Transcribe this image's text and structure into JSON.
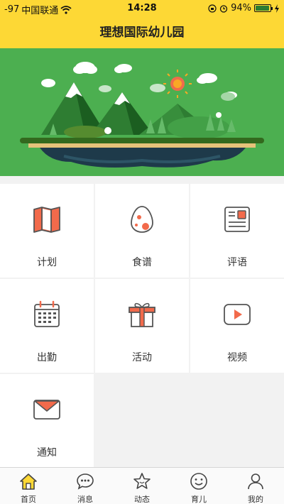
{
  "status": {
    "signal": "-97",
    "carrier": "中国联通",
    "time": "14:28",
    "battery_pct": "94%",
    "battery_level": 0.94
  },
  "header": {
    "title": "理想国际幼儿园"
  },
  "features": [
    {
      "label": "计划",
      "icon": "plan-map-icon"
    },
    {
      "label": "食谱",
      "icon": "recipe-egg-icon"
    },
    {
      "label": "评语",
      "icon": "comment-card-icon"
    },
    {
      "label": "出勤",
      "icon": "attendance-calendar-icon"
    },
    {
      "label": "活动",
      "icon": "activity-gift-icon"
    },
    {
      "label": "视频",
      "icon": "video-play-icon"
    },
    {
      "label": "通知",
      "icon": "notice-envelope-icon"
    }
  ],
  "tabs": [
    {
      "label": "首页",
      "icon": "home-icon",
      "active": true
    },
    {
      "label": "消息",
      "icon": "chat-icon",
      "active": false
    },
    {
      "label": "动态",
      "icon": "star-icon",
      "active": false
    },
    {
      "label": "育儿",
      "icon": "smile-icon",
      "active": false
    },
    {
      "label": "我的",
      "icon": "user-icon",
      "active": false
    }
  ],
  "colors": {
    "header_bg": "#fdd835",
    "banner_bg": "#4caf50",
    "icon_orange": "#f26a4b",
    "icon_outline": "#555555"
  }
}
